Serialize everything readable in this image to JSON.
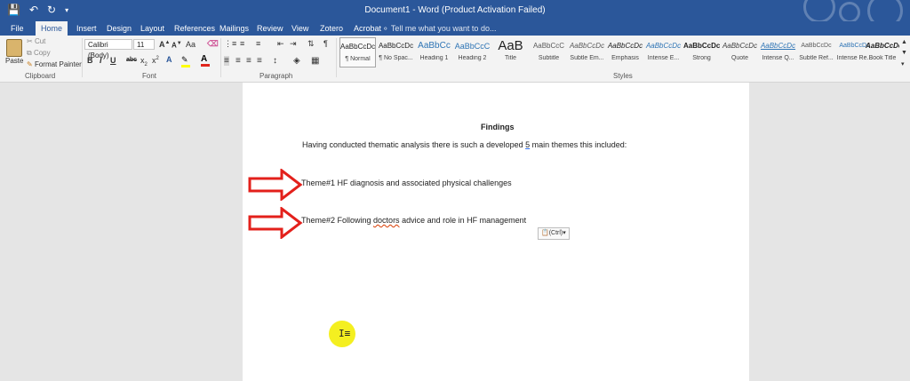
{
  "titlebar": {
    "document_title": "Document1 - Word (Product Activation Failed)",
    "qat": {
      "save_icon": "save-icon",
      "undo_icon": "undo-icon",
      "repeat_icon": "repeat-icon",
      "customize_icon": "customize-qat-icon"
    }
  },
  "tabs": [
    "File",
    "Home",
    "Insert",
    "Design",
    "Layout",
    "References",
    "Mailings",
    "Review",
    "View",
    "Zotero",
    "Acrobat"
  ],
  "active_tab": "Home",
  "tell_me": "Tell me what you want to do...",
  "clipboard": {
    "paste": "Paste",
    "cut": "Cut",
    "copy": "Copy",
    "format_painter": "Format Painter",
    "label": "Clipboard"
  },
  "font": {
    "font_name": "Calibri (Body)",
    "font_size": "11",
    "grow": "A",
    "shrink": "A",
    "case": "Aa",
    "bold": "B",
    "italic": "I",
    "underline": "U",
    "strike": "abc",
    "subscript": "x",
    "superscript": "x",
    "label": "Font"
  },
  "paragraph": {
    "label": "Paragraph"
  },
  "styles": {
    "label": "Styles",
    "items": [
      {
        "preview": "AaBbCcDc",
        "name": "¶ Normal"
      },
      {
        "preview": "AaBbCcDc",
        "name": "¶ No Spac..."
      },
      {
        "preview": "AaBbCc",
        "name": "Heading 1"
      },
      {
        "preview": "AaBbCcC",
        "name": "Heading 2"
      },
      {
        "preview": "AaB",
        "name": "Title"
      },
      {
        "preview": "AaBbCcC",
        "name": "Subtitle"
      },
      {
        "preview": "AaBbCcDc",
        "name": "Subtle Em..."
      },
      {
        "preview": "AaBbCcDc",
        "name": "Emphasis"
      },
      {
        "preview": "AaBbCcDc",
        "name": "Intense E..."
      },
      {
        "preview": "AaBbCcDc",
        "name": "Strong"
      },
      {
        "preview": "AaBbCcDc",
        "name": "Quote"
      },
      {
        "preview": "AaBbCcDc",
        "name": "Intense Q..."
      },
      {
        "preview": "AaBbCcDc",
        "name": "Subtle Ref..."
      },
      {
        "preview": "AaBbCcDc",
        "name": "Intense Re..."
      },
      {
        "preview": "AaBbCcDc",
        "name": "Book Title"
      }
    ]
  },
  "document": {
    "heading": "Findings",
    "intro_before": "Having conducted thematic analysis there is such a developed ",
    "intro_num": "5",
    "intro_after": " main themes this included:",
    "theme1": "Theme#1 HF diagnosis and associated physical challenges",
    "theme2_before": "Theme#2 Following ",
    "theme2_word": "doctors",
    "theme2_after": " advice and role in HF management",
    "paste_options": "(Ctrl)"
  },
  "colors": {
    "word_blue": "#2b579a",
    "annotation_red": "#e3201b",
    "cursor_highlight": "#f4ef20"
  }
}
